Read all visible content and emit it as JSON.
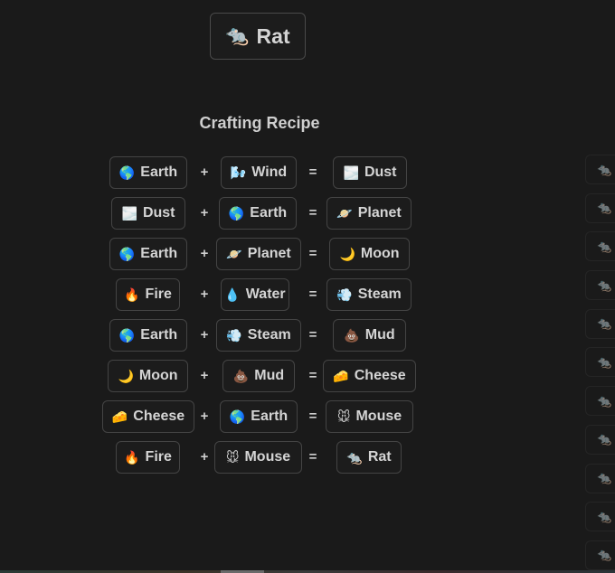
{
  "header": {
    "element": {
      "emoji": "🐀",
      "icon": "rat-icon",
      "label": "Rat"
    }
  },
  "section_title": "Crafting Recipe",
  "operators": {
    "plus": "+",
    "equals": "="
  },
  "recipes": [
    {
      "a": {
        "emoji": "🌎",
        "name": "Earth"
      },
      "b": {
        "emoji": "🌬️",
        "name": "Wind"
      },
      "result": {
        "emoji": "🌫️",
        "name": "Dust"
      }
    },
    {
      "a": {
        "emoji": "🌫️",
        "name": "Dust"
      },
      "b": {
        "emoji": "🌎",
        "name": "Earth"
      },
      "result": {
        "emoji": "🪐",
        "name": "Planet"
      }
    },
    {
      "a": {
        "emoji": "🌎",
        "name": "Earth"
      },
      "b": {
        "emoji": "🪐",
        "name": "Planet"
      },
      "result": {
        "emoji": "🌙",
        "name": "Moon"
      }
    },
    {
      "a": {
        "emoji": "🔥",
        "name": "Fire"
      },
      "b": {
        "emoji": "💧",
        "name": "Water"
      },
      "result": {
        "emoji": "💨",
        "name": "Steam"
      }
    },
    {
      "a": {
        "emoji": "🌎",
        "name": "Earth"
      },
      "b": {
        "emoji": "💨",
        "name": "Steam"
      },
      "result": {
        "emoji": "💩",
        "name": "Mud"
      }
    },
    {
      "a": {
        "emoji": "🌙",
        "name": "Moon"
      },
      "b": {
        "emoji": "💩",
        "name": "Mud"
      },
      "result": {
        "emoji": "🧀",
        "name": "Cheese"
      }
    },
    {
      "a": {
        "emoji": "🧀",
        "name": "Cheese"
      },
      "b": {
        "emoji": "🌎",
        "name": "Earth"
      },
      "result": {
        "emoji": "🐭",
        "name": "Mouse"
      }
    },
    {
      "a": {
        "emoji": "🔥",
        "name": "Fire"
      },
      "b": {
        "emoji": "🐭",
        "name": "Mouse"
      },
      "result": {
        "emoji": "🐀",
        "name": "Rat"
      }
    }
  ],
  "side_list": {
    "items": [
      "🐀",
      "🐀",
      "🐀",
      "🐀",
      "🐀",
      "🐀",
      "🐀",
      "🐀",
      "🐀",
      "🐀",
      "🐀"
    ]
  }
}
